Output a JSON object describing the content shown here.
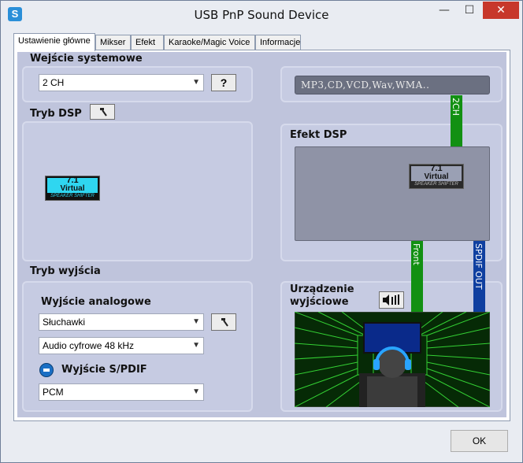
{
  "window": {
    "title": "USB PnP Sound Device",
    "minimize": "—",
    "maximize": "☐",
    "close": "✕",
    "app_icon": "S"
  },
  "tabs": [
    {
      "label": "Ustawienie główne"
    },
    {
      "label": "Mikser"
    },
    {
      "label": "Efekt"
    },
    {
      "label": "Karaoke/Magic Voice"
    },
    {
      "label": "Informacje"
    }
  ],
  "system_input": {
    "title": "Wejście systemowe",
    "selected": "2 CH",
    "help_label": "?",
    "formats": "MP3,CD,VCD,Wav,WMA.."
  },
  "dsp_mode": {
    "title": "Tryb DSP",
    "tool_icon": "hammer-icon"
  },
  "badge": {
    "line1": "7.1",
    "line2": "Virtual",
    "line3": "SPEAKER SHIFTER"
  },
  "dsp_effect": {
    "title": "Efekt DSP"
  },
  "connectors": {
    "ch2": "2CH",
    "front": "Front",
    "spdif": "SPDIF OUT"
  },
  "output_mode": {
    "title": "Tryb wyjścia",
    "analog_title": "Wyjście analogowe",
    "analog_selected": "Słuchawki",
    "digital_selected": "Audio cyfrowe 48 kHz",
    "spdif_title": "Wyjście S/PDIF",
    "spdif_selected": "PCM"
  },
  "output_device": {
    "title_line1": "Urządzenie",
    "title_line2": "wyjściowe"
  },
  "footer": {
    "ok_label": "OK"
  },
  "colors": {
    "panel": "#bfc4dc",
    "green": "#129012",
    "blue": "#0f3fa0",
    "close": "#c7372b"
  }
}
